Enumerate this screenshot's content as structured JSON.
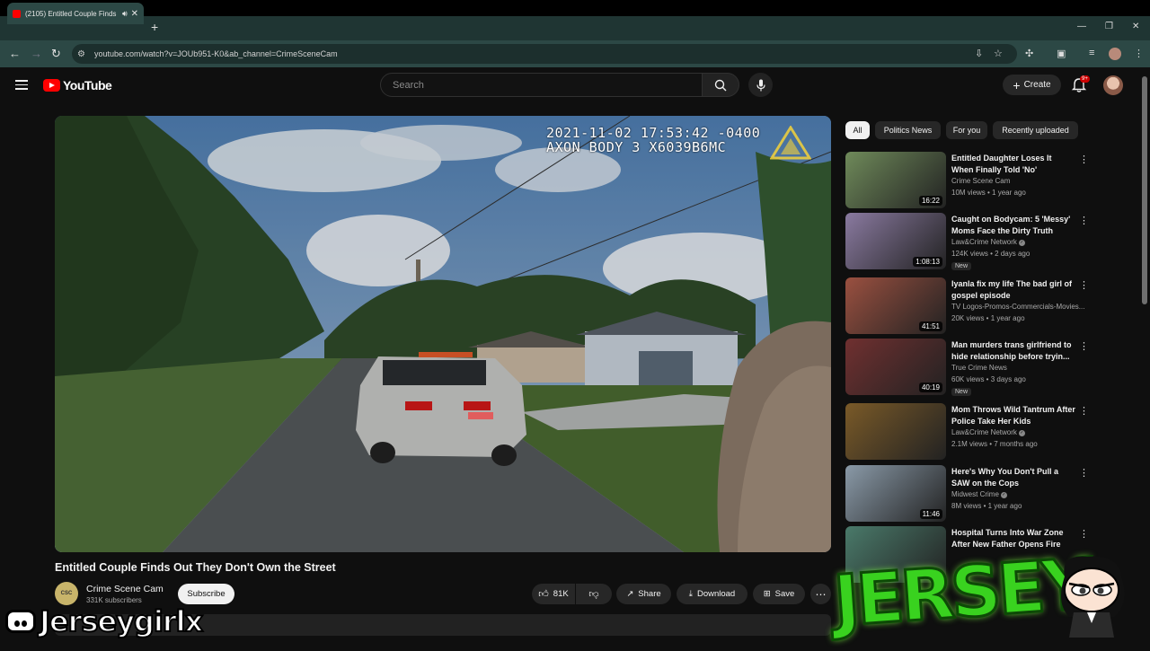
{
  "browser": {
    "tab_title": "(2105) Entitled Couple Finds",
    "url": "youtube.com/watch?v=JOUb951-K0&ab_channel=CrimeSceneCam"
  },
  "header": {
    "logo_text": "YouTube",
    "search_placeholder": "Search",
    "create_label": "Create",
    "notification_count": "9+"
  },
  "video": {
    "overlay_timestamp": "2021-11-02 17:53:42 -0400",
    "overlay_device": "AXON BODY 3 X6039B6MC",
    "title": "Entitled Couple Finds Out They Don't Own the Street",
    "channel": "Crime Scene Cam",
    "channel_avatar_text": "CSC",
    "subscribers": "331K subscribers",
    "subscribe_label": "Subscribe",
    "likes": "81K",
    "share_label": "Share",
    "download_label": "Download",
    "save_label": "Save"
  },
  "chips": [
    "All",
    "Politics News",
    "For you",
    "Recently uploaded"
  ],
  "recommendations": [
    {
      "title": "Entitled Daughter Loses It When Finally Told 'No'",
      "channel": "Crime Scene Cam",
      "verified": false,
      "meta": "10M views • 1 year ago",
      "duration": "16:22",
      "new": false,
      "color": "#6f8a5a"
    },
    {
      "title": "Caught on Bodycam: 5 'Messy' Moms Face the Dirty Truth",
      "channel": "Law&Crime Network",
      "verified": true,
      "meta": "124K views • 2 days ago",
      "duration": "1:08:13",
      "new": true,
      "color": "#8a7aa0"
    },
    {
      "title": "Iyanla fix my life The bad girl of gospel episode",
      "channel": "TV Logos-Promos-Commercials-Movies...",
      "verified": false,
      "meta": "20K views • 1 year ago",
      "duration": "41:51",
      "new": false,
      "color": "#9a5040"
    },
    {
      "title": "Man murders trans girlfriend to hide relationship before tryin...",
      "channel": "True Crime News",
      "verified": false,
      "meta": "60K views • 3 days ago",
      "duration": "40:19",
      "new": true,
      "color": "#703030"
    },
    {
      "title": "Mom Throws Wild Tantrum After Police Take Her Kids",
      "channel": "Law&Crime Network",
      "verified": true,
      "meta": "2.1M views • 7 months ago",
      "duration": "",
      "new": false,
      "color": "#7a5a28"
    },
    {
      "title": "Here's Why You Don't Pull a SAW on the Cops",
      "channel": "Midwest Crime",
      "verified": true,
      "meta": "8M views • 1 year ago",
      "duration": "11:46",
      "new": false,
      "color": "#8a9aa8"
    },
    {
      "title": "Hospital Turns Into War Zone After New Father Opens Fire",
      "channel": "",
      "verified": false,
      "meta": "",
      "duration": "",
      "new": false,
      "color": "#4a7a6a"
    }
  ],
  "overlay": {
    "streamer_tag": "Jerseygirlx",
    "logo_word": "JERSEY"
  }
}
